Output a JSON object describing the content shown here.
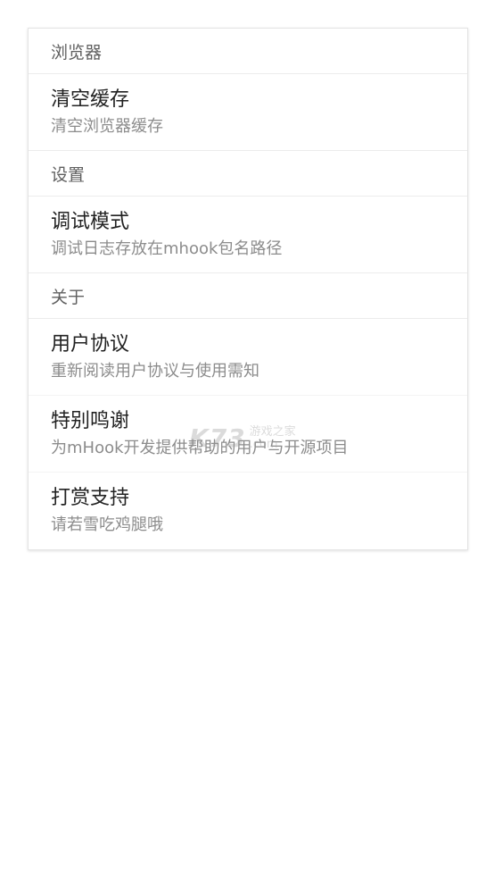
{
  "sections": [
    {
      "header": "浏览器",
      "items": [
        {
          "title": "清空缓存",
          "subtitle": "清空浏览器缓存"
        }
      ]
    },
    {
      "header": "设置",
      "items": [
        {
          "title": "调试模式",
          "subtitle": "调试日志存放在mhook包名路径"
        }
      ]
    },
    {
      "header": "关于",
      "items": [
        {
          "title": "用户协议",
          "subtitle": "重新阅读用户协议与使用需知"
        },
        {
          "title": "特别鸣谢",
          "subtitle": "为mHook开发提供帮助的用户与开源项目"
        },
        {
          "title": "打赏支持",
          "subtitle": "请若雪吃鸡腿哦"
        }
      ]
    }
  ],
  "watermark": {
    "logo": "K73",
    "line1": "游戏之家",
    "line2": ".com"
  }
}
